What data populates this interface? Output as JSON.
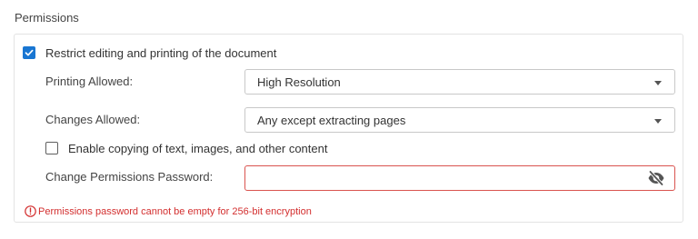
{
  "section": {
    "title": "Permissions"
  },
  "restrict": {
    "label": "Restrict editing and printing of the document",
    "checked": true
  },
  "printing": {
    "label": "Printing Allowed:",
    "value": "High Resolution"
  },
  "changes": {
    "label": "Changes Allowed:",
    "value": "Any except extracting pages"
  },
  "copying": {
    "label": "Enable copying of text, images, and other content",
    "checked": false
  },
  "password": {
    "label": "Change Permissions Password:",
    "value": "",
    "toggle_icon": "eye-off-icon"
  },
  "error": {
    "message": "Permissions password cannot be empty for 256-bit encryption",
    "icon": "error-circle-icon"
  },
  "colors": {
    "accent": "#1976d2",
    "error": "#d32f2f",
    "error_border": "#d9534f"
  }
}
